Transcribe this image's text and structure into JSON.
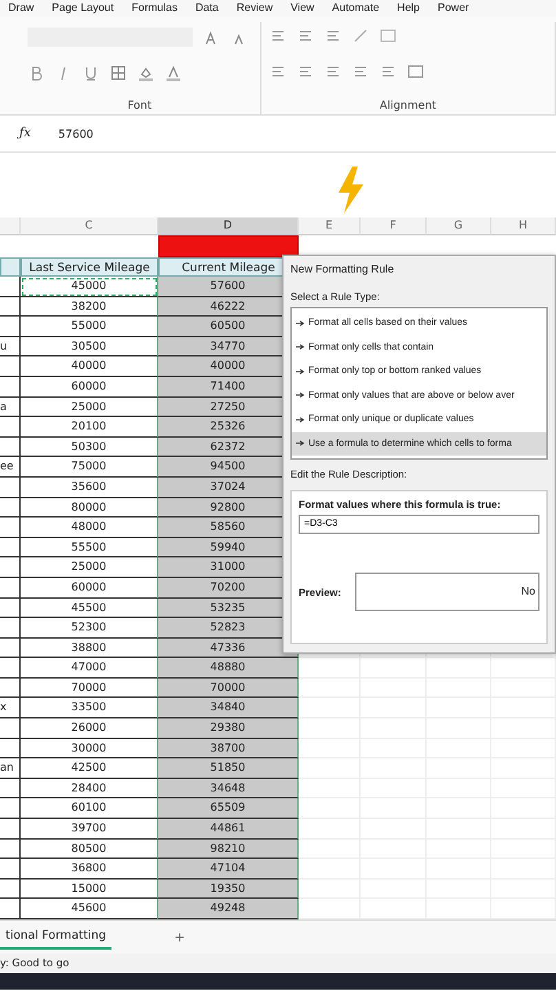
{
  "menu_tabs": [
    "Draw",
    "Page Layout",
    "Formulas",
    "Data",
    "Review",
    "View",
    "Automate",
    "Help",
    "Power"
  ],
  "ribbon": {
    "groups": [
      "Font",
      "Alignment"
    ]
  },
  "formula_bar": {
    "function_label": "ƒx",
    "value": "57600"
  },
  "columns": [
    {
      "label": "C",
      "selected": false
    },
    {
      "label": "D",
      "selected": true
    },
    {
      "label": "E",
      "selected": false
    },
    {
      "label": "F",
      "selected": false
    },
    {
      "label": "G",
      "selected": false
    },
    {
      "label": "H",
      "selected": false
    }
  ],
  "headers": [
    "Last Service Mileage",
    "Current Mileage"
  ],
  "rows": [
    {
      "b": "",
      "c": "45000",
      "d": "57600"
    },
    {
      "b": "",
      "c": "38200",
      "d": "46222"
    },
    {
      "b": "",
      "c": "55000",
      "d": "60500"
    },
    {
      "b": "u",
      "c": "30500",
      "d": "34770"
    },
    {
      "b": "",
      "c": "40000",
      "d": "40000"
    },
    {
      "b": "",
      "c": "60000",
      "d": "71400"
    },
    {
      "b": "a",
      "c": "25000",
      "d": "27250"
    },
    {
      "b": "",
      "c": "20100",
      "d": "25326"
    },
    {
      "b": "",
      "c": "50300",
      "d": "62372"
    },
    {
      "b": "ee",
      "c": "75000",
      "d": "94500"
    },
    {
      "b": "",
      "c": "35600",
      "d": "37024"
    },
    {
      "b": "",
      "c": "80000",
      "d": "92800"
    },
    {
      "b": "",
      "c": "48000",
      "d": "58560"
    },
    {
      "b": "",
      "c": "55500",
      "d": "59940"
    },
    {
      "b": "",
      "c": "25000",
      "d": "31000"
    },
    {
      "b": "",
      "c": "60000",
      "d": "70200"
    },
    {
      "b": "",
      "c": "45500",
      "d": "53235"
    },
    {
      "b": "",
      "c": "52300",
      "d": "52823"
    },
    {
      "b": "",
      "c": "38800",
      "d": "47336"
    },
    {
      "b": "",
      "c": "47000",
      "d": "48880"
    },
    {
      "b": "",
      "c": "70000",
      "d": "70000"
    },
    {
      "b": "x",
      "c": "33500",
      "d": "34840"
    },
    {
      "b": "",
      "c": "26000",
      "d": "29380"
    },
    {
      "b": "",
      "c": "30000",
      "d": "38700"
    },
    {
      "b": "an",
      "c": "42500",
      "d": "51850"
    },
    {
      "b": "",
      "c": "28400",
      "d": "34648"
    },
    {
      "b": "",
      "c": "60100",
      "d": "65509"
    },
    {
      "b": "",
      "c": "39700",
      "d": "44861"
    },
    {
      "b": "",
      "c": "80500",
      "d": "98210"
    },
    {
      "b": "",
      "c": "36800",
      "d": "47104"
    },
    {
      "b": "",
      "c": "15000",
      "d": "19350"
    },
    {
      "b": "",
      "c": "45600",
      "d": "49248"
    }
  ],
  "dialog": {
    "title": "New Formatting Rule",
    "select_label": "Select a Rule Type:",
    "rule_types": [
      {
        "label": "Format all cells based on their values",
        "selected": false
      },
      {
        "label": "Format only cells that contain",
        "selected": false
      },
      {
        "label": "Format only top or bottom ranked values",
        "selected": false
      },
      {
        "label": "Format only values that are above or below aver",
        "selected": false
      },
      {
        "label": "Format only unique or duplicate values",
        "selected": false
      },
      {
        "label": "Use a formula to determine which cells to forma",
        "selected": true
      }
    ],
    "edit_label": "Edit the Rule Description:",
    "formula_label": "Format values where this formula is true:",
    "formula": "=D3-C3",
    "preview_label": "Preview:",
    "preview_text": "No"
  },
  "sheet_tabs": [
    {
      "label": "tional Formatting",
      "selected": true
    }
  ],
  "add_sheet": "+",
  "status_bar": "y: Good to go"
}
